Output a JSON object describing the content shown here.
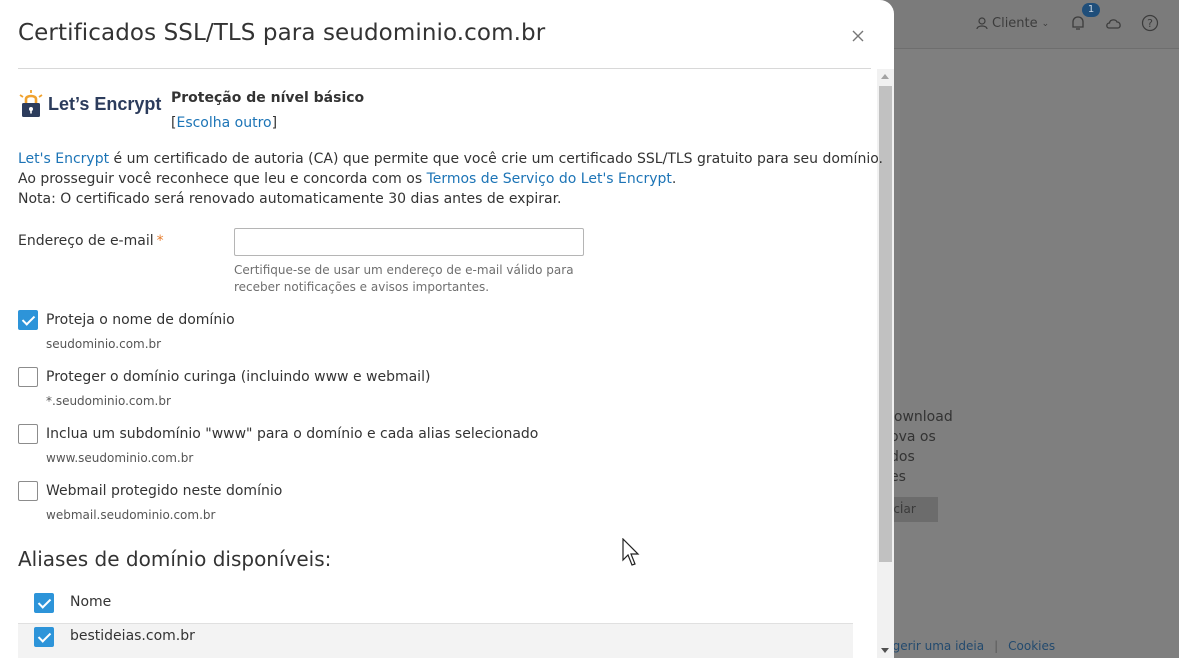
{
  "background": {
    "user_menu_label": "Cliente",
    "notification_count": "1",
    "text_lines": [
      "lownload",
      "ova os",
      "dos",
      "es"
    ],
    "button_label": "ıcİar",
    "footer_links": [
      "ugerir uma ideia",
      "Cookies"
    ]
  },
  "modal": {
    "title": "Certificados SSL/TLS para seudominio.com.br",
    "provider_logo_text": "Let’s Encrypt",
    "protection_level": "Proteção de nível básico",
    "choose_other_bracket_open": "[",
    "choose_other_link": "Escolha outro",
    "choose_other_bracket_close": "]",
    "description": {
      "line1_link": "Let's Encrypt",
      "line1_rest": " é um certificado de autoria (CA) que permite que você crie um certificado SSL/TLS gratuito para seu domínio.",
      "line2_start": "Ao prosseguir você reconhece que leu e concorda com os ",
      "line2_link": "Termos de Serviço do Let's Encrypt",
      "line2_end": ".",
      "line3": "Nota: O certificado será renovado automaticamente 30 dias antes de expirar."
    },
    "email": {
      "label": "Endereço de e-mail",
      "required_mark": "*",
      "value": "",
      "placeholder": "",
      "hint": "Certifique-se de usar um endereço de e-mail válido para receber notificações e avisos importantes."
    },
    "options": [
      {
        "label": "Proteja o nome de domínio",
        "sub": "seudominio.com.br",
        "checked": true
      },
      {
        "label": "Proteger o domínio curinga (incluindo www e webmail)",
        "sub": "*.seudominio.com.br",
        "checked": false
      },
      {
        "label": "Inclua um subdomínio \"www\" para o domínio e cada alias selecionado",
        "sub": "www.seudominio.com.br",
        "checked": false
      },
      {
        "label": "Webmail protegido neste domínio",
        "sub": "webmail.seudominio.com.br",
        "checked": false
      }
    ],
    "aliases": {
      "title": "Aliases de domínio disponíveis:",
      "column_header": "Nome",
      "rows": [
        {
          "name": "bestideias.com.br",
          "checked": true
        }
      ]
    }
  },
  "colors": {
    "accent": "#2d94d9",
    "link": "#1c74b6",
    "required": "#e57b2c",
    "overlay": "#7f7f7f"
  },
  "icons": [
    "user-icon",
    "notification-bell-icon",
    "cloud-icon",
    "help-icon",
    "close-icon",
    "lets-encrypt-lock-icon",
    "mouse-cursor-icon"
  ]
}
